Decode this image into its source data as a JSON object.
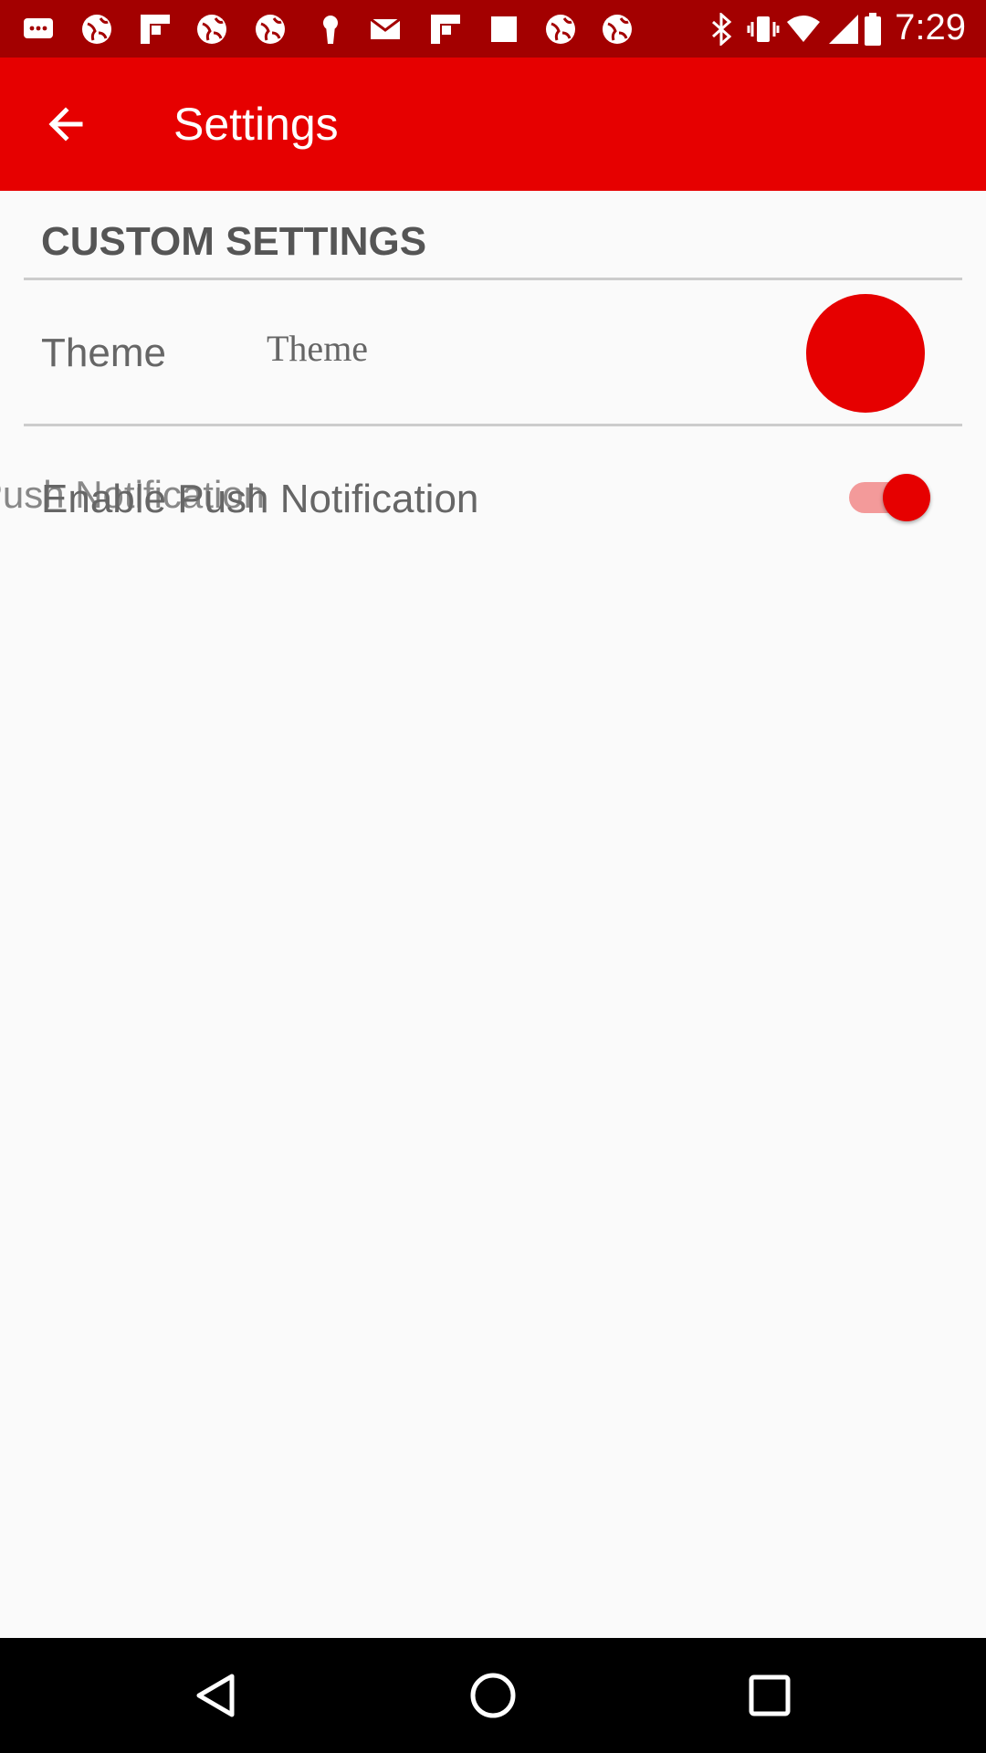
{
  "status_bar": {
    "time": "7:29",
    "icons": [
      "messaging-icon",
      "globe-icon",
      "flipboard-icon",
      "globe-icon",
      "globe-icon",
      "keyhole-icon",
      "email-icon",
      "flipboard-icon",
      "square-icon",
      "globe-icon",
      "globe-icon",
      "bluetooth-icon",
      "vibrate-icon",
      "wifi-icon",
      "cellular-signal-icon",
      "battery-icon"
    ]
  },
  "app_bar": {
    "title": "Settings",
    "background": "#e60000"
  },
  "settings": {
    "section_header": "CUSTOM SETTINGS",
    "theme": {
      "label": "Theme",
      "value": "Theme",
      "swatch_color": "#e60000"
    },
    "push": {
      "label": "Enable Push Notification",
      "ghost_text": "Enable Push Notification",
      "enabled": true
    }
  },
  "nav_bar": {
    "buttons": [
      "back-triangle-icon",
      "home-circle-icon",
      "recents-square-icon"
    ]
  }
}
